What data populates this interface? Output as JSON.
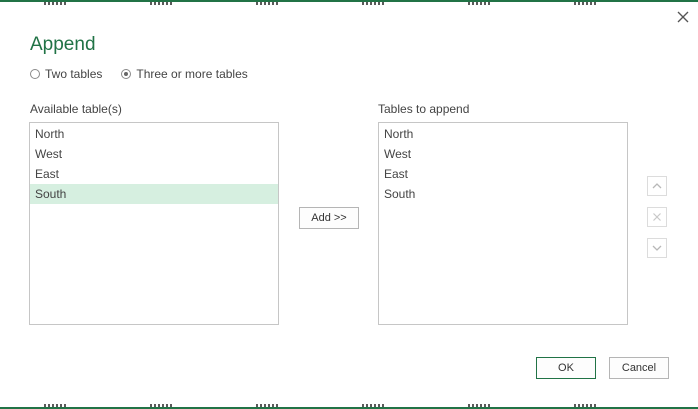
{
  "dialog": {
    "title": "Append",
    "accent_color": "#217346"
  },
  "mode": {
    "options": [
      {
        "label": "Two tables",
        "checked": false
      },
      {
        "label": "Three or more tables",
        "checked": true
      }
    ]
  },
  "available": {
    "label": "Available table(s)",
    "items": [
      "North",
      "West",
      "East",
      "South"
    ],
    "selected": "South"
  },
  "append": {
    "label": "Tables to append",
    "items": [
      "North",
      "West",
      "East",
      "South"
    ]
  },
  "buttons": {
    "add": "Add >>",
    "ok": "OK",
    "cancel": "Cancel"
  },
  "icons": {
    "close": "close-icon",
    "move_up": "chevron-up-icon",
    "remove": "remove-x-icon",
    "move_down": "chevron-down-icon"
  }
}
